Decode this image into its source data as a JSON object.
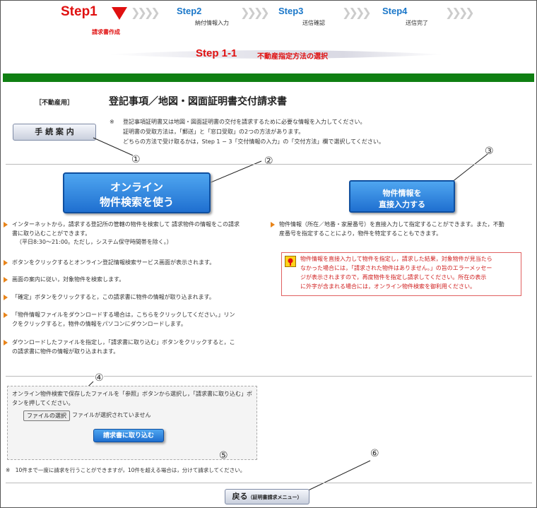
{
  "steps": {
    "step1": {
      "label": "Step1",
      "sub": "請求書作成"
    },
    "step2": {
      "label": "Step2",
      "sub": "納付情報入力"
    },
    "step3": {
      "label": "Step3",
      "sub": "送信確認"
    },
    "step4": {
      "label": "Step4",
      "sub": "送信完了"
    }
  },
  "section": {
    "step_label": "Step 1-1",
    "title": "不動産指定方法の選択"
  },
  "header": {
    "tag": "［不動産用］",
    "title": "登記事項／地図・図面証明書交付請求書"
  },
  "notes": {
    "mark": "※",
    "line1": "登記事項証明書又は地図・図面証明書の交付を請求するために必要な情報を入力してください。",
    "line2": "証明書の受取方法は，「郵送」と「窓口受取」の2つの方法があります。",
    "line3": "どちらの方法で受け取るかは，Step 1 − 3「交付情報の入力」の「交付方法」欄で選択してください。"
  },
  "guide_button": "手 続 案 内",
  "callouts": {
    "c1": "①",
    "c2": "②",
    "c3": "③",
    "c4": "④",
    "c5": "⑤",
    "c6": "⑥"
  },
  "online_button": {
    "line1": "オンライン",
    "line2": "物件検索を使う"
  },
  "direct_button": {
    "line1": "物件情報を",
    "line2": "直接入力する"
  },
  "left_bullets": {
    "b1a": "インターネットから，請求する登記所の管轄の物件を検索して 請求物件の情報をこの請求",
    "b1b": "書に取り込むことができます。",
    "b1c": "（平日8:30〜21:00。ただし，システム保守時間帯を除く。）",
    "b2": "ボタンをクリックするとオンライン登記情報検索サービス画面が表示されます。",
    "b3": "画面の案内に従い，対象物件を検索します。",
    "b4": "「確定」ボタンをクリックすると，この請求書に物件の情報が取り込まれます。",
    "b5a": "「物件情報ファイルをダウンロードする場合は，こちらをクリックしてください。」リン",
    "b5b": "クをクリックすると，物件の情報をパソコンにダウンロードします。",
    "b6a": "ダウンロードしたファイルを指定し，「請求書に取り込む」ボタンをクリックすると，こ",
    "b6b": "の請求書に物件の情報が取り込まれます。"
  },
  "right_bullet": {
    "a": "物件情報（所在／地番・家屋番号）を直接入力して指定することができます。また，不動",
    "b": "産番号を指定することにより，物件を特定することもできます。"
  },
  "warning": {
    "l1": "物件情報を直接入力して物件を指定し，請求した結果，対象物件が見当たら",
    "l2": "なかった場合には，「請求された物件はありません。」の旨のエラーメッセー",
    "l3": "ジが表示されますので，再度物件を指定し請求してください。所在の表示",
    "l4": "に外字が含まれる場合には，オンライン物件検索を御利用ください。"
  },
  "file_box": {
    "text1": "オンライン物件検索で保存したファイルを「参照」ボタンから選択し，「請求書に取り込む」ボ",
    "text2": "タンを押してください。",
    "choose_button": "ファイルの選択",
    "no_file": "ファイルが選択されていません",
    "import_button": "請求書に取り込む"
  },
  "footer_note": "※　10件まで一度に請求を行うことができますが，10件を超える場合は，分けて請求してください。",
  "back_button": {
    "main": "戻る",
    "sub": "（証明書請求メニュー）"
  }
}
